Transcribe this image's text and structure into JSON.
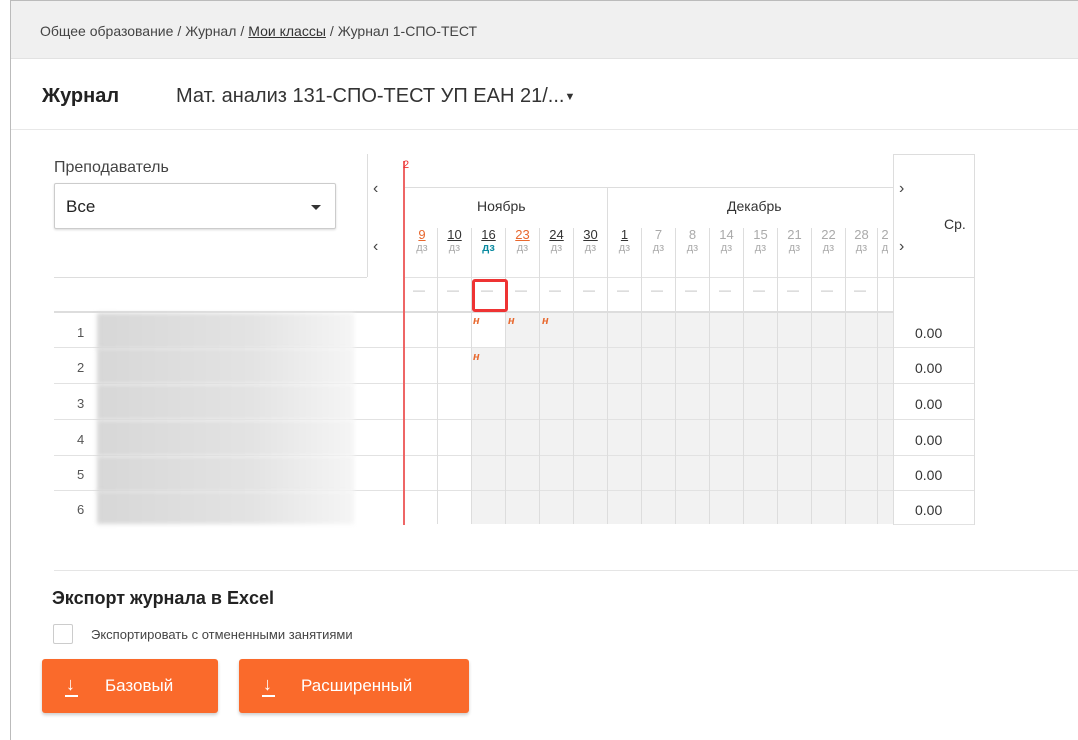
{
  "breadcrumb": {
    "items": [
      "Общее образование",
      "Журнал",
      "Мои классы",
      "Журнал 1-СПО-ТЕСТ"
    ]
  },
  "header": {
    "title": "Журнал",
    "subject": "Мат. анализ 131-СПО-ТЕСТ УП ЕАН 21/..."
  },
  "filter": {
    "teacher_label": "Преподаватель",
    "teacher_value": "Все"
  },
  "grid": {
    "lesson_marker": "2",
    "months": [
      "Ноябрь",
      "Декабрь"
    ],
    "dates": [
      {
        "day": "9",
        "type": "дз"
      },
      {
        "day": "10",
        "type": "дз"
      },
      {
        "day": "16",
        "type": "дз"
      },
      {
        "day": "23",
        "type": "дз"
      },
      {
        "day": "24",
        "type": "дз"
      },
      {
        "day": "30",
        "type": "дз"
      },
      {
        "day": "1",
        "type": "дз"
      },
      {
        "day": "7",
        "type": "дз"
      },
      {
        "day": "8",
        "type": "дз"
      },
      {
        "day": "14",
        "type": "дз"
      },
      {
        "day": "15",
        "type": "дз"
      },
      {
        "day": "21",
        "type": "дз"
      },
      {
        "day": "22",
        "type": "дз"
      },
      {
        "day": "28",
        "type": "дз"
      },
      {
        "day": "2",
        "type": "д"
      }
    ],
    "dash": "—",
    "avg_header": "Ср.",
    "rows": [
      {
        "num": "1",
        "avg": "0.00",
        "marks": [
          "н",
          "н",
          "н"
        ]
      },
      {
        "num": "2",
        "avg": "0.00",
        "marks": [
          "н"
        ]
      },
      {
        "num": "3",
        "avg": "0.00",
        "marks": []
      },
      {
        "num": "4",
        "avg": "0.00",
        "marks": []
      },
      {
        "num": "5",
        "avg": "0.00",
        "marks": []
      },
      {
        "num": "6",
        "avg": "0.00",
        "marks": []
      }
    ]
  },
  "export": {
    "title": "Экспорт журнала в Excel",
    "checkbox_label": "Экспортировать с отмененными занятиями",
    "checkbox_checked": false,
    "basic_label": "Базовый",
    "extended_label": "Расширенный"
  },
  "colors": {
    "accent": "#fa6a2b",
    "highlight": "#e33333",
    "date_link_orange": "#e8682e",
    "dz_active": "#0a8aa0"
  }
}
